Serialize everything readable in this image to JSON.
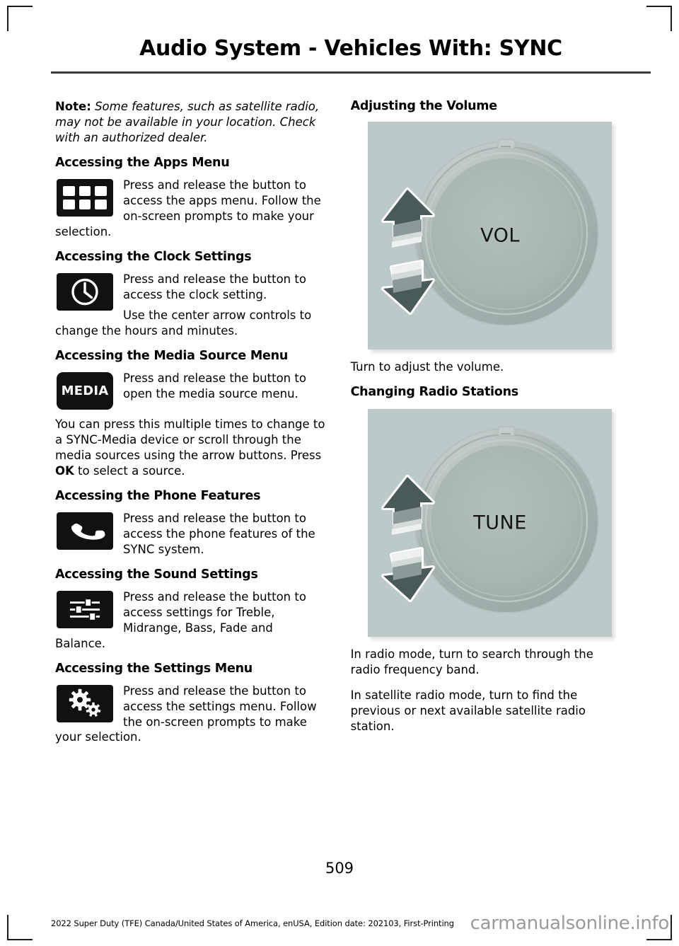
{
  "document": {
    "title": "Audio System - Vehicles With: SYNC",
    "page_number": "509",
    "edition_line": "2022 Super Duty (TFE) Canada/United States of America, enUSA, Edition date: 202103, First-Printing",
    "watermark": "carmanualsonline.info"
  },
  "left_column": {
    "note": {
      "label": "Note:",
      "text": " Some features, such as satellite radio, may not be available in your location. Check with an authorized dealer."
    },
    "sections": [
      {
        "heading": "Accessing the Apps Menu",
        "icon": "apps-grid-icon",
        "icon_text": "",
        "body": "Press and release the button to access the apps menu. Follow the on-screen prompts to make your selection."
      },
      {
        "heading": "Accessing the Clock Settings",
        "icon": "clock-icon",
        "icon_text": "",
        "body": "Press and release the button to access the clock setting.",
        "body2": "Use the center arrow controls to change the hours and minutes."
      },
      {
        "heading": "Accessing the Media Source Menu",
        "icon": "media-button-icon",
        "icon_text": "MEDIA",
        "body": "Press and release the button to open the media source menu.",
        "body2_pre": "You can press this multiple times to change to a SYNC-Media device or scroll through the media sources using the arrow buttons. Press ",
        "body2_bold": "OK",
        "body2_post": " to select a source."
      },
      {
        "heading": "Accessing the Phone Features",
        "icon": "phone-icon",
        "icon_text": "",
        "body": "Press and release the button to access the phone features of the SYNC system."
      },
      {
        "heading": "Accessing the Sound Settings",
        "icon": "sound-sliders-icon",
        "icon_text": "",
        "body": "Press and release the button to access settings for Treble, Midrange, Bass, Fade and Balance."
      },
      {
        "heading": "Accessing the Settings Menu",
        "icon": "gears-icon",
        "icon_text": "",
        "body": "Press and release the button to access the settings menu. Follow the on-screen prompts to make your selection."
      }
    ]
  },
  "right_column": {
    "volume": {
      "heading": "Adjusting the Volume",
      "knob_label": "VOL",
      "caption": "Turn to adjust the volume."
    },
    "radio": {
      "heading": "Changing Radio Stations",
      "knob_label": "TUNE",
      "caption1": "In radio mode, turn to search through the radio frequency band.",
      "caption2": "In satellite radio mode, turn to find the previous or next available satellite radio station."
    }
  },
  "colors": {
    "icon_background": "#111111",
    "figure_background": "#bdc8c8",
    "knob_face": "#a8b5b2",
    "arrow_dark": "#4a5a58",
    "arrow_mid": "#8b9a98",
    "rule": "#3a3a3a"
  }
}
